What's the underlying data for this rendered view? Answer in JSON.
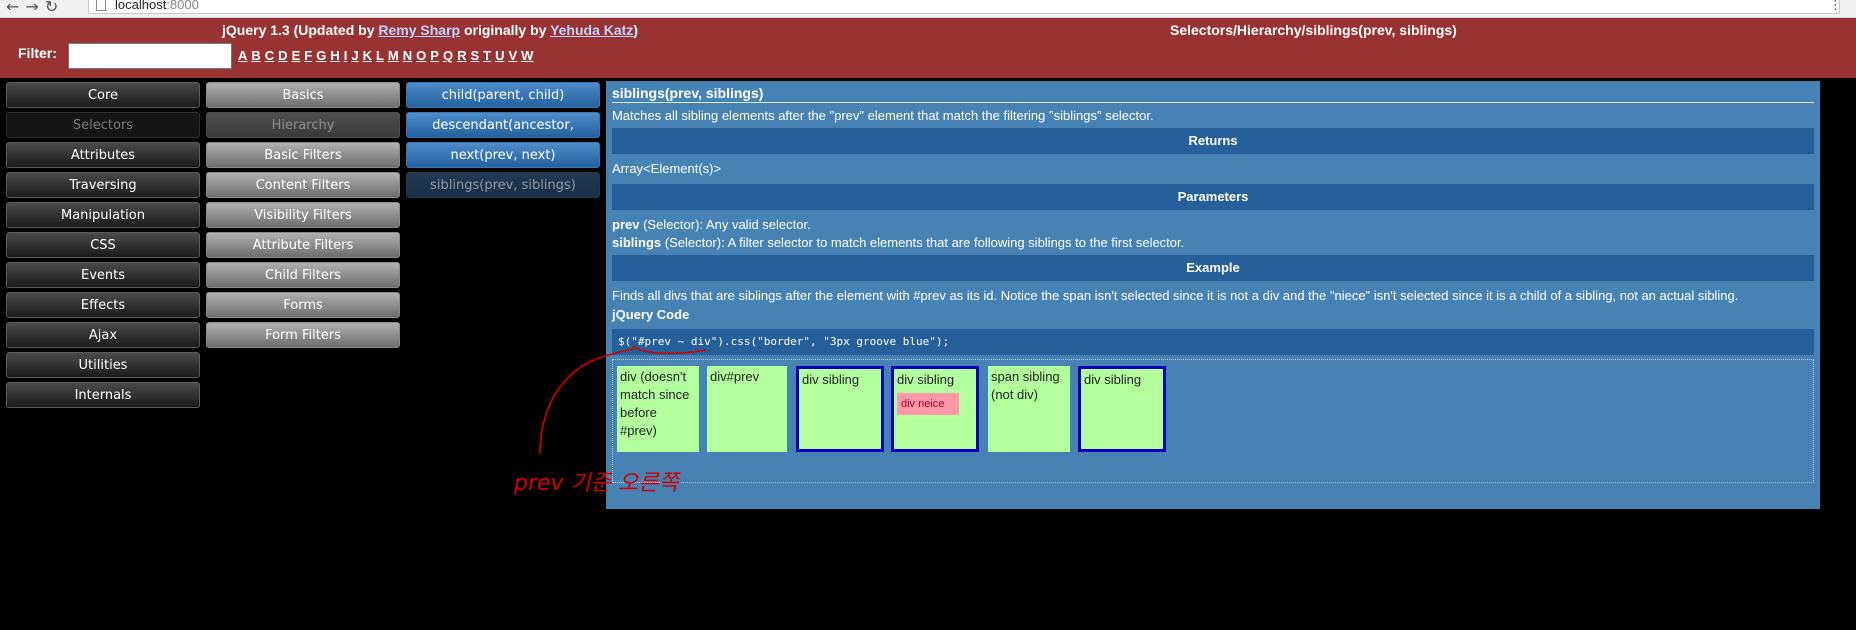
{
  "browser": {
    "url_host": "localhost",
    "url_port": ":8000"
  },
  "header": {
    "title_prefix": "jQuery 1.3 (Updated by ",
    "author1": "Remy Sharp",
    "title_mid": " originally by ",
    "author2": "Yehuda Katz",
    "title_suffix": ")",
    "path": "Selectors/Hierarchy/siblings(prev, siblings)",
    "filter_label": "Filter:",
    "filter_value": "",
    "letters": [
      "A",
      "B",
      "C",
      "D",
      "E",
      "F",
      "G",
      "H",
      "I",
      "J",
      "K",
      "L",
      "M",
      "N",
      "O",
      "P",
      "Q",
      "R",
      "S",
      "T",
      "U",
      "V",
      "W"
    ]
  },
  "menu": {
    "categories": [
      "Core",
      "Selectors",
      "Attributes",
      "Traversing",
      "Manipulation",
      "CSS",
      "Events",
      "Effects",
      "Ajax",
      "Utilities",
      "Internals"
    ],
    "subcategories": [
      "Basics",
      "Hierarchy",
      "Basic Filters",
      "Content Filters",
      "Visibility Filters",
      "Attribute Filters",
      "Child Filters",
      "Forms",
      "Form Filters"
    ],
    "methods": [
      "child(parent, child)",
      "descendant(ancestor,",
      "next(prev, next)",
      "siblings(prev, siblings)"
    ]
  },
  "doc": {
    "title": "siblings(prev, siblings)",
    "description": "Matches all sibling elements after the \"prev\" element that match the filtering \"siblings\" selector.",
    "returns_heading": "Returns",
    "returns_value": "Array<Element(s)>",
    "parameters_heading": "Parameters",
    "param1_name": "prev",
    "param1_desc": " (Selector): Any valid selector.",
    "param2_name": "siblings",
    "param2_desc": " (Selector): A filter selector to match elements that are following siblings to the first selector.",
    "example_heading": "Example",
    "example_desc": "Finds all divs that are siblings after the element with #prev as its id. Notice the span isn't selected since it is not a div and the \"niece\" isn't selected since it is a child of a sibling, not an actual sibling.",
    "code_heading": "jQuery Code",
    "code": "$(\"#prev ~ div\").css(\"border\", \"3px groove blue\");",
    "demo": {
      "box1": "div (doesn't match since before #prev)",
      "box2": "div#prev",
      "box3": "div sibling",
      "box4": "div sibling",
      "niece": "div neice",
      "box5": "span sibling (not div)",
      "box6": "div sibling"
    }
  },
  "annotation": {
    "handwritten_note": "prev 기준 오른쪽"
  },
  "colors": {
    "header": "#993333",
    "panel": "#4682b4",
    "band": "#26609a",
    "demo_box": "#b3ff9e",
    "annotation": "#d40000"
  }
}
